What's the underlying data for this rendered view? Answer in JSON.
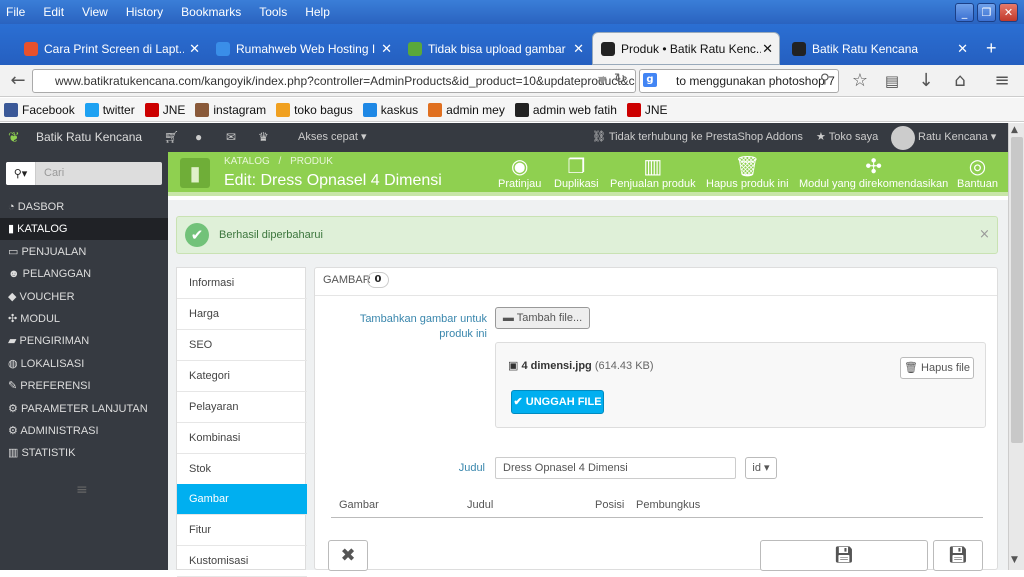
{
  "menu": [
    "File",
    "Edit",
    "View",
    "History",
    "Bookmarks",
    "Tools",
    "Help"
  ],
  "tabs": [
    {
      "title": "Cara Print Screen di Lapt...",
      "color": "#e8512d"
    },
    {
      "title": "Rumahweb Web Hosting I...",
      "color": "#3a8ee8"
    },
    {
      "title": "Tidak bisa upload gambar ...",
      "color": "#5aa83a"
    },
    {
      "title": "Produk • Batik Ratu Kenc...",
      "color": "#222"
    },
    {
      "title": "Batik Ratu Kencana",
      "color": "#222"
    }
  ],
  "url": "www.batikratukencana.com/kangoyik/index.php?controller=AdminProducts&id_product=10&updateproduct&co",
  "search_text": "to menggunakan photoshop 7",
  "bookmarks": [
    {
      "label": "Facebook",
      "color": "#3b5998"
    },
    {
      "label": "twitter",
      "color": "#1da1f2"
    },
    {
      "label": "JNE",
      "color": "#c00"
    },
    {
      "label": "instagram",
      "color": "#8a5a3a"
    },
    {
      "label": "toko bagus",
      "color": "#f0a020"
    },
    {
      "label": "kaskus",
      "color": "#1e88e5"
    },
    {
      "label": "admin mey",
      "color": "#e07020"
    },
    {
      "label": "admin web fatih",
      "color": "#222"
    },
    {
      "label": "JNE",
      "color": "#c00"
    }
  ],
  "admin": {
    "shop_name": "Batik Ratu Kencana",
    "quick_access": "Akses cepat",
    "addons_status": "Tidak terhubung ke PrestaShop Addons",
    "my_shop": "Toko saya",
    "user": "Ratu Kencana"
  },
  "sidebar": {
    "search_placeholder": "Cari",
    "items": [
      "DASBOR",
      "KATALOG",
      "PENJUALAN",
      "PELANGGAN",
      "VOUCHER",
      "MODUL",
      "PENGIRIMAN",
      "LOKALISASI",
      "PREFERENSI",
      "PARAMETER LANJUTAN",
      "ADMINISTRASI",
      "STATISTIK"
    ]
  },
  "toolbar": {
    "breadcrumb_1": "KATALOG",
    "breadcrumb_sep": "/",
    "breadcrumb_2": "PRODUK",
    "title": "Edit: Dress Opnasel 4 Dimensi",
    "buttons": [
      "Pratinjau",
      "Duplikasi",
      "Penjualan produk",
      "Hapus produk ini",
      "Modul yang direkomendasikan",
      "Bantuan"
    ]
  },
  "alert": {
    "message": "Berhasil diperbaharui",
    "close": "×"
  },
  "product_tabs": [
    "Informasi",
    "Harga",
    "SEO",
    "Kategori",
    "Pelayaran",
    "Kombinasi",
    "Stok",
    "Gambar",
    "Fitur",
    "Kustomisasi"
  ],
  "panel": {
    "heading": "GAMBAR",
    "count": "0",
    "add_image_label": "Tambahkan gambar untuk produk ini",
    "add_file_button": "Tambah file...",
    "file_name": "4 dimensi.jpg",
    "file_size": "(614.43 KB)",
    "delete_file_button": "Hapus file",
    "upload_button": "UNGGAH FILE",
    "title_label": "Judul",
    "title_value": "Dress Opnasel 4 Dimensi",
    "lang": "id",
    "columns": [
      "Gambar",
      "Judul",
      "Posisi",
      "Pembungkus"
    ]
  }
}
